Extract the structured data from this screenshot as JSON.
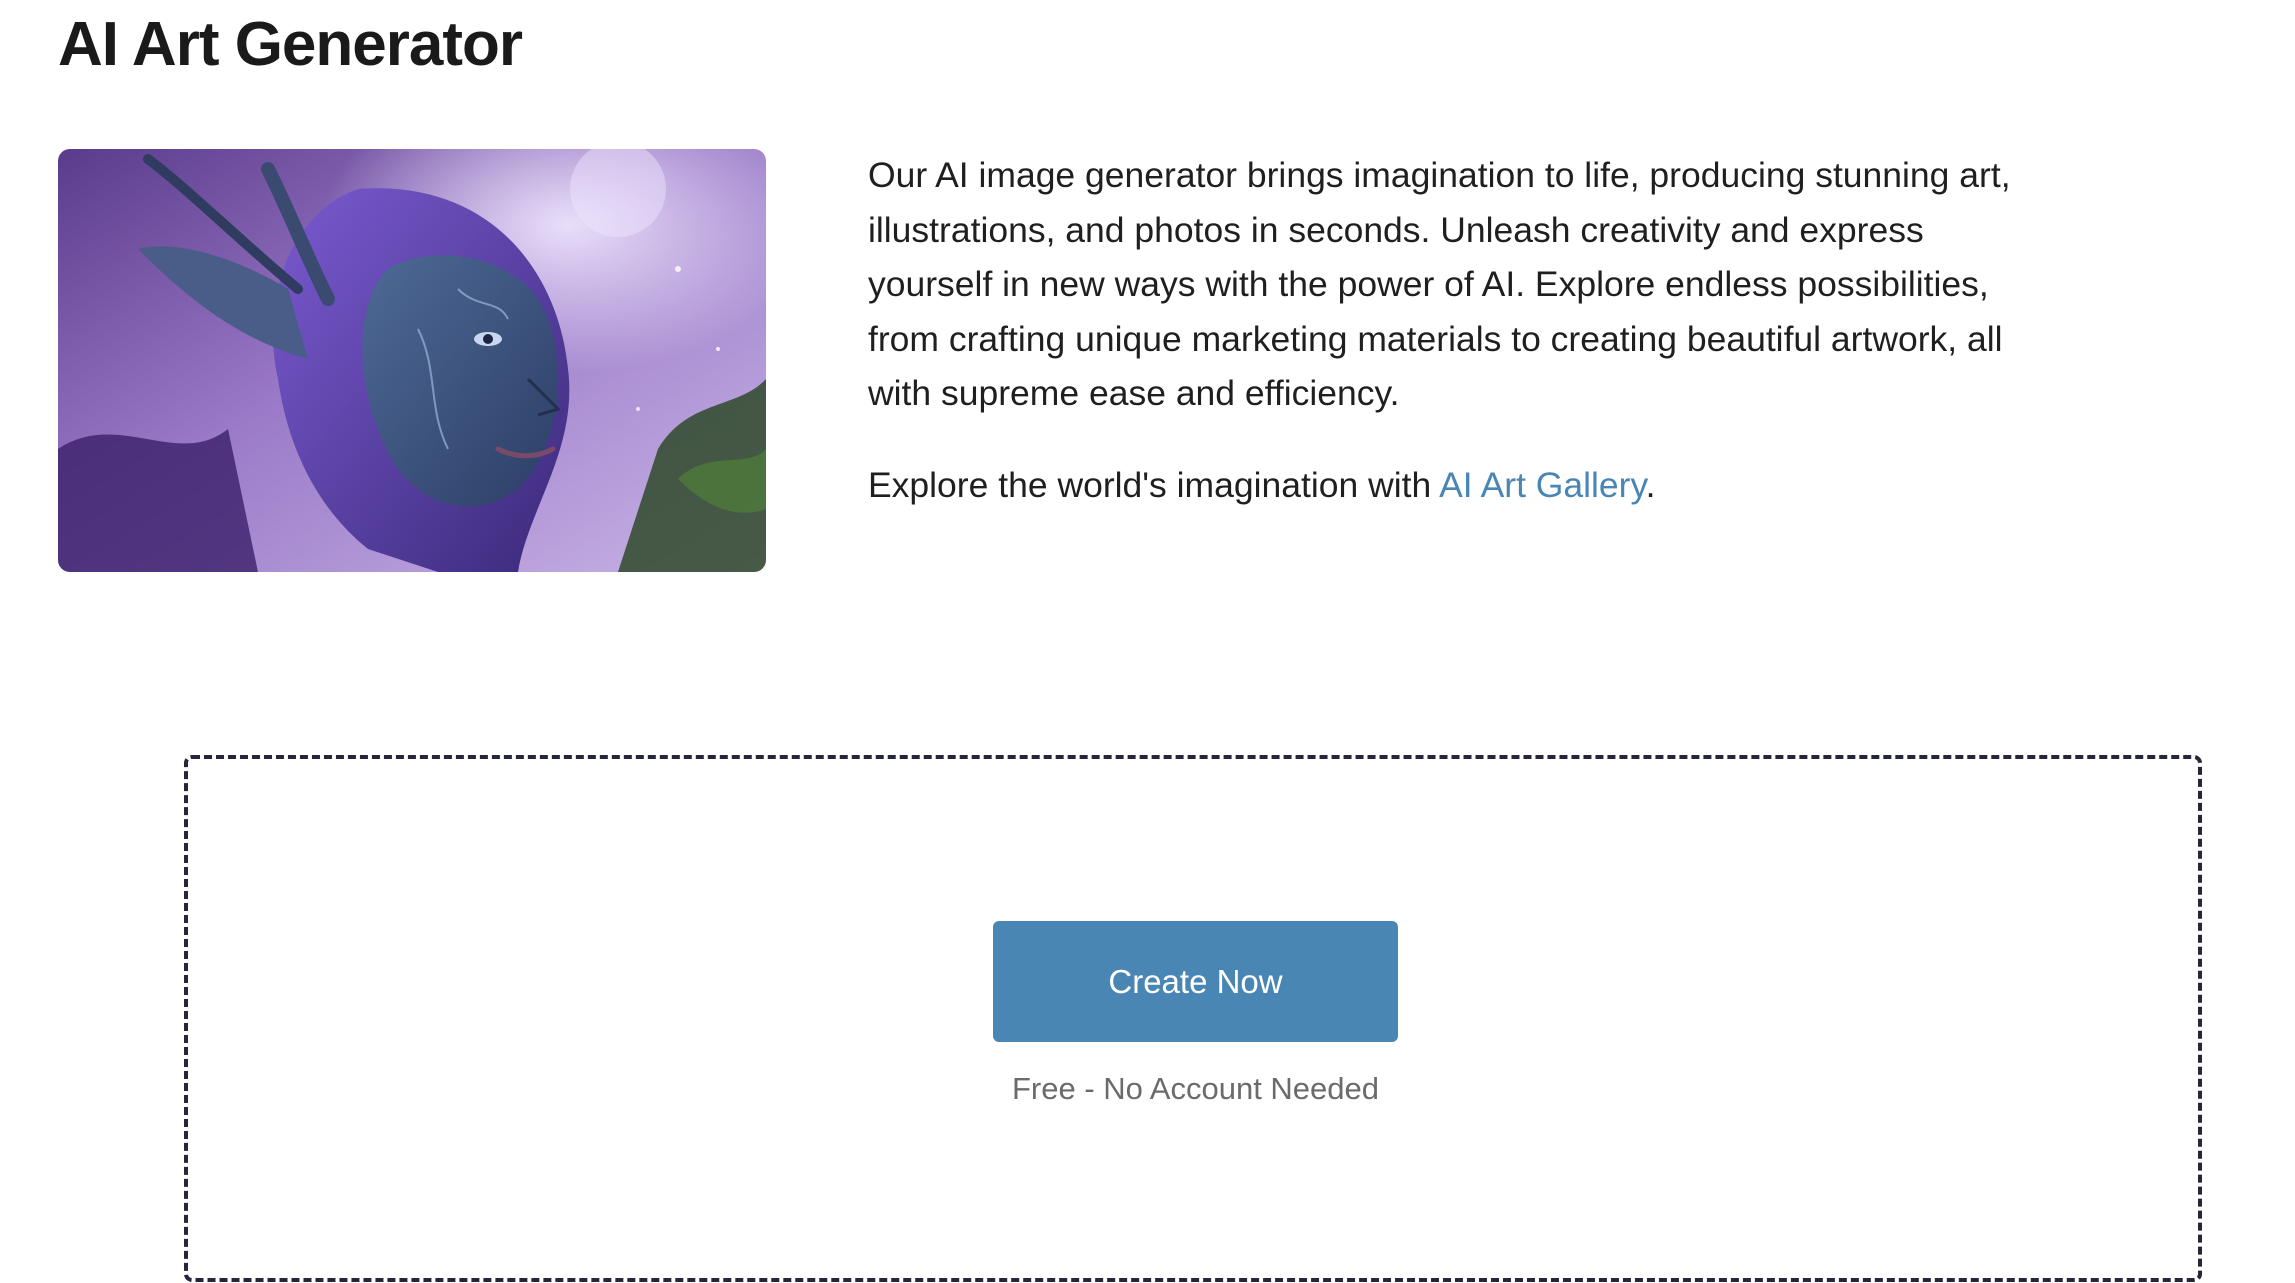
{
  "page": {
    "title": "AI Art Generator"
  },
  "intro": {
    "lines": [
      "Our AI image generator brings imagination to life, producing stunning art,",
      "illustrations, and photos in seconds. Unleash creativity and express",
      "yourself in new ways with the power of AI. Explore endless possibilities,",
      "from crafting unique marketing materials to creating beautiful artwork, all",
      "with supreme ease and efficiency."
    ],
    "explore_prefix": "Explore the world's imagination with ",
    "gallery_link": "AI Art Gallery",
    "explore_suffix": "."
  },
  "cta": {
    "button_label": "Create Now",
    "note": "Free - No Account Needed"
  },
  "colors": {
    "accent": "#4a86b4",
    "text": "#1f1f1f",
    "muted": "#6b6b6b",
    "dashed_border": "#26263a"
  }
}
